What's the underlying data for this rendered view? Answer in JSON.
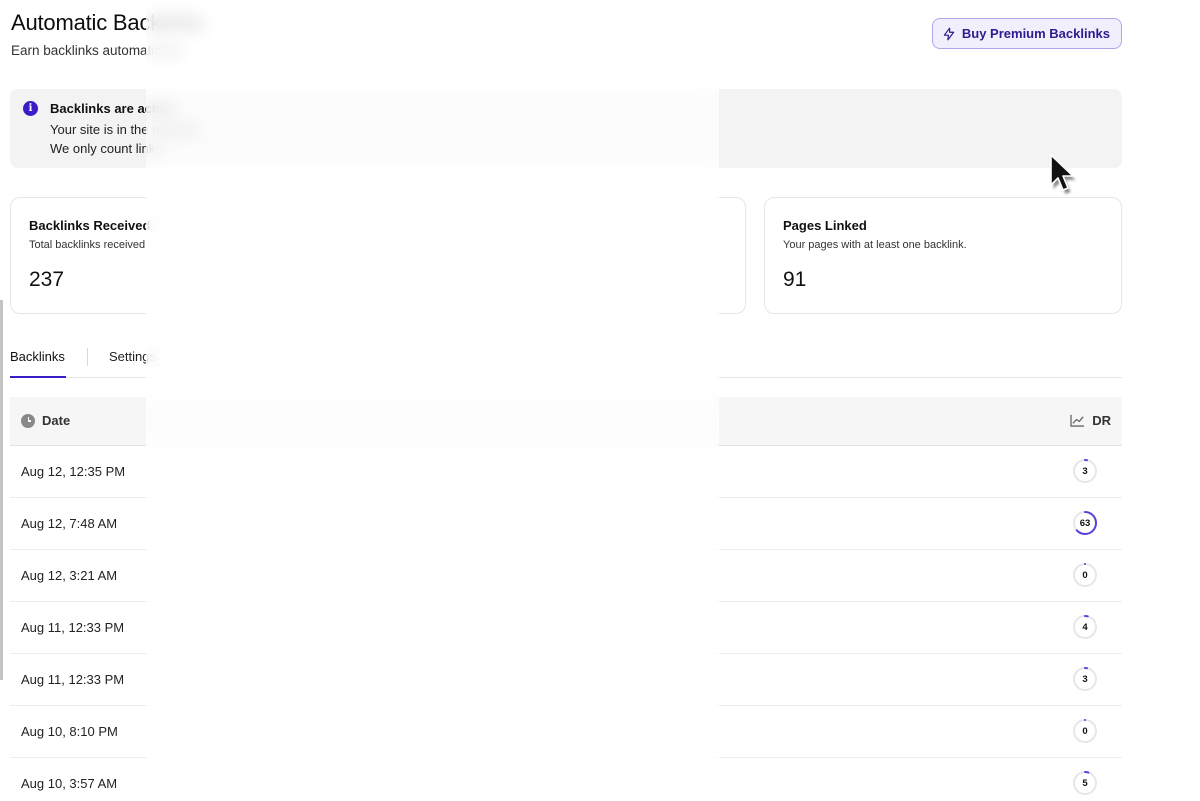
{
  "header": {
    "title": "Automatic Backlinks",
    "subtitle": "Earn backlinks automatically",
    "premium_button": "Buy Premium Backlinks"
  },
  "notice": {
    "title": "Backlinks are active",
    "line1": "Your site is in the network",
    "line2": "We only count links"
  },
  "stats": [
    {
      "title": "Backlinks Received",
      "desc": "Total backlinks received",
      "value": "237"
    },
    {
      "title": "",
      "desc": "",
      "value": ""
    },
    {
      "title": "Pages Linked",
      "desc": "Your pages with at least one backlink.",
      "value": "91"
    }
  ],
  "tabs": {
    "backlinks": "Backlinks",
    "settings": "Settings"
  },
  "table": {
    "headers": {
      "date": "Date",
      "domain": "",
      "anchor": "",
      "dr": "DR"
    },
    "rows": [
      {
        "date": "Aug 12, 12:35 PM",
        "domain": "",
        "anchor": "",
        "dr": 3
      },
      {
        "date": "Aug 12, 7:48 AM",
        "domain": "",
        "anchor": "",
        "dr": 63
      },
      {
        "date": "Aug 12, 3:21 AM",
        "domain": "",
        "anchor": "",
        "dr": 0
      },
      {
        "date": "Aug 11, 12:33 PM",
        "domain": "",
        "anchor": "",
        "dr": 4
      },
      {
        "date": "Aug 11, 12:33 PM",
        "domain": "",
        "anchor": "",
        "dr": 3
      },
      {
        "date": "Aug 10, 8:10 PM",
        "domain": "",
        "anchor": "",
        "dr": 0
      },
      {
        "date": "Aug 10, 3:57 AM",
        "domain": "",
        "anchor": "",
        "dr": 5
      }
    ]
  },
  "colors": {
    "accent": "#3b1cc7",
    "dr_ring": "#5b3fd9",
    "dr_track": "#e6e6e6",
    "notice_bg": "#f3f3f3"
  },
  "icons": {
    "premium": "lightning-icon",
    "info": "info-icon",
    "date": "clock-icon",
    "dr": "line-chart-icon",
    "cursor": "mouse-pointer-icon"
  }
}
